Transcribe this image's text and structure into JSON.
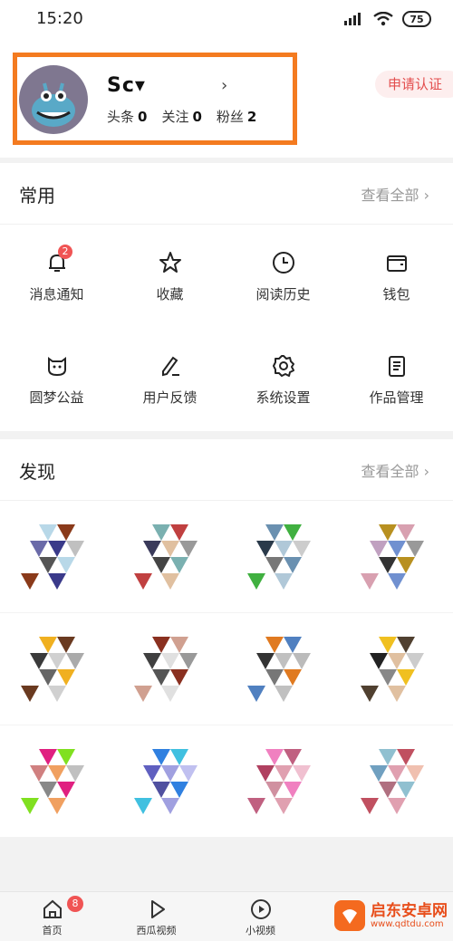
{
  "status_bar": {
    "time": "15:20",
    "battery": "75"
  },
  "profile": {
    "username": "Sc▾",
    "stats": [
      {
        "label": "头条",
        "value": "0"
      },
      {
        "label": "关注",
        "value": "0"
      },
      {
        "label": "粉丝",
        "value": "2"
      }
    ],
    "apply_label": "申请认证"
  },
  "common": {
    "title": "常用",
    "more": "查看全部 ›",
    "items": [
      {
        "label": "消息通知",
        "icon": "bell-icon",
        "badge": "2"
      },
      {
        "label": "收藏",
        "icon": "star-icon"
      },
      {
        "label": "阅读历史",
        "icon": "clock-icon"
      },
      {
        "label": "钱包",
        "icon": "wallet-icon"
      },
      {
        "label": "圆梦公益",
        "icon": "charity-icon"
      },
      {
        "label": "用户反馈",
        "icon": "feedback-icon"
      },
      {
        "label": "系统设置",
        "icon": "gear-icon"
      },
      {
        "label": "作品管理",
        "icon": "works-icon"
      }
    ]
  },
  "discover": {
    "title": "发现",
    "more": "查看全部 ›"
  },
  "tabbar": {
    "items": [
      {
        "label": "首页",
        "icon": "home-icon",
        "badge": "8"
      },
      {
        "label": "西瓜视频",
        "icon": "play-icon"
      },
      {
        "label": "小视频",
        "icon": "short-video-icon"
      }
    ]
  },
  "watermark": {
    "name": "启东安卓网",
    "url": "www.qdtdu.com"
  },
  "colors": {
    "highlight": "#f47b20",
    "badge": "#f05454",
    "accent_red": "#e34d4d"
  }
}
